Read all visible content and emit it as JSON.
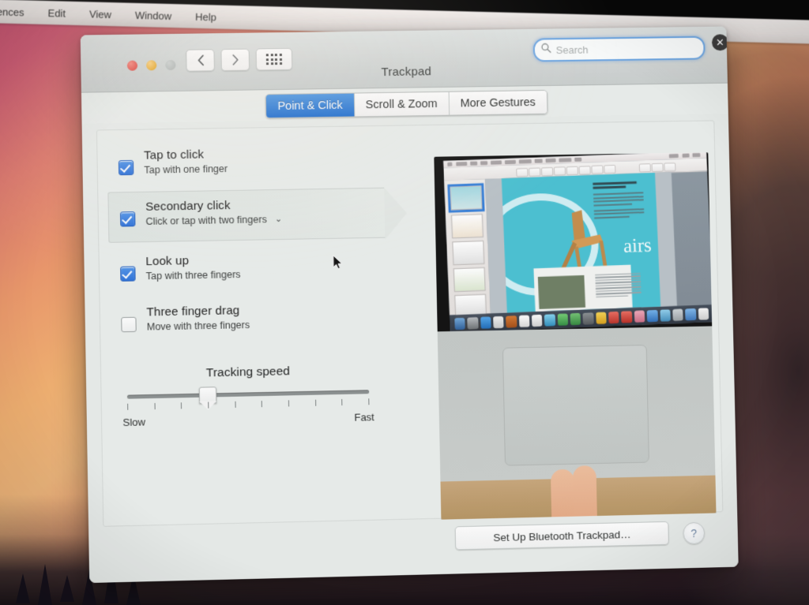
{
  "menubar": {
    "items": [
      "rences",
      "Edit",
      "View",
      "Window",
      "Help"
    ]
  },
  "window": {
    "title": "Trackpad",
    "traffic_lights": [
      "close",
      "minimize",
      "zoom"
    ],
    "nav": {
      "back_icon": "chevron-left-icon",
      "forward_icon": "chevron-right-icon",
      "grid_icon": "show-all-grid-icon"
    },
    "search": {
      "placeholder": "Search",
      "value": "",
      "icon": "search-icon",
      "clear_icon": "clear-circle-icon"
    }
  },
  "tabs": [
    {
      "label": "Point & Click",
      "selected": true
    },
    {
      "label": "Scroll & Zoom",
      "selected": false
    },
    {
      "label": "More Gestures",
      "selected": false
    }
  ],
  "options": [
    {
      "title": "Tap to click",
      "subtitle": "Tap with one finger",
      "checked": true,
      "highlighted": false,
      "dropdown": false
    },
    {
      "title": "Secondary click",
      "subtitle": "Click or tap with two fingers",
      "checked": true,
      "highlighted": true,
      "dropdown": true
    },
    {
      "title": "Look up",
      "subtitle": "Tap with three fingers",
      "checked": true,
      "highlighted": false,
      "dropdown": false
    },
    {
      "title": "Three finger drag",
      "subtitle": "Move with three fingers",
      "checked": false,
      "highlighted": false,
      "dropdown": false
    }
  ],
  "slider": {
    "label": "Tracking speed",
    "min_label": "Slow",
    "max_label": "Fast",
    "value_percent": 33,
    "tick_count": 10
  },
  "bottom": {
    "setup_button": "Set Up Bluetooth Trackpad…",
    "help_button": "?"
  },
  "preview": {
    "caption_word": "airs",
    "app": "Pages",
    "description": "Trackpad demo video: Pages document above a trackpad with fingers"
  },
  "colors": {
    "accent_blue": "#2b73e2",
    "tab_selected": "#1a6fd8",
    "window_bg": "#e9edeb",
    "titlebar": "#d2d7d6",
    "search_focus_ring": "#69a7e8",
    "wallpaper_sky": "#e8976b",
    "wallpaper_pink": "#c14a6b"
  }
}
